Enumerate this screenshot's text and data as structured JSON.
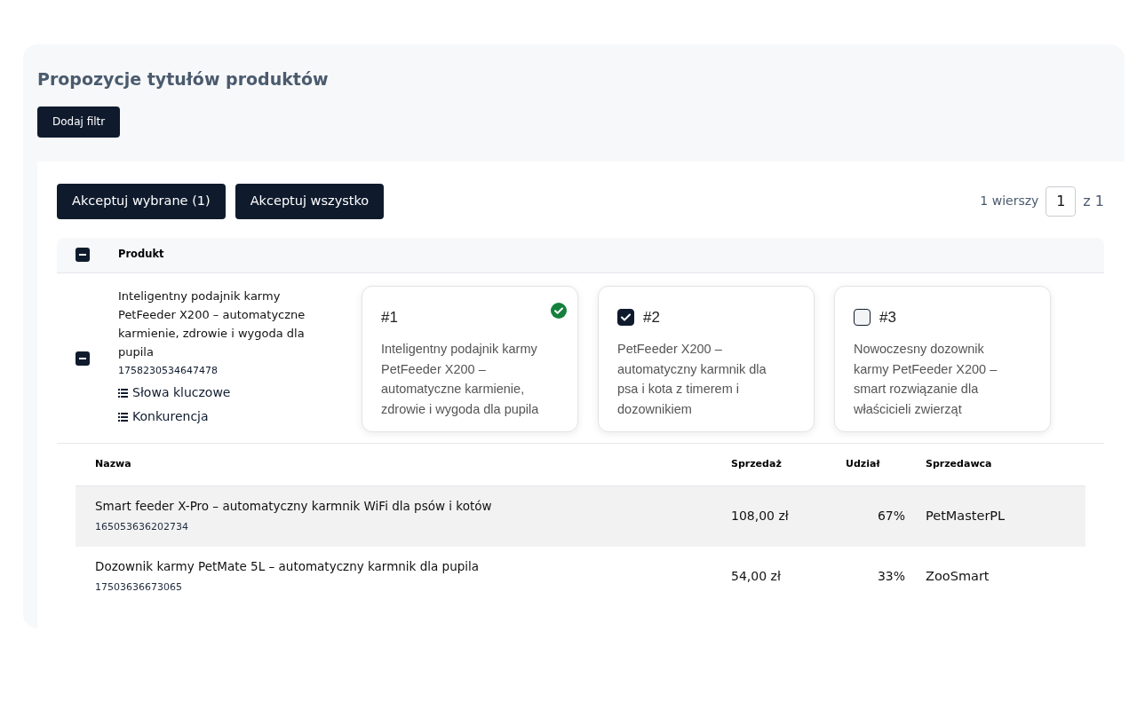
{
  "title": "Propozycje tytułów produktów",
  "filter_button": "Dodaj filtr",
  "actions": [
    "Akceptuj wybrane (1)",
    "Akceptuj wszystko"
  ],
  "pagination": {
    "rows_label": "1 wierszy",
    "page": "1",
    "of": "z 1"
  },
  "table": {
    "header": {
      "indeterminate": true,
      "column": "Produkt"
    },
    "product": {
      "indeterminate": true,
      "name": "Inteligentny podajnik karmy PetFeeder X200 – automatyczne karmienie, zdrowie i wygoda dla pupila",
      "id": "1758230534647478",
      "links": [
        "Słowa kluczowe",
        "Konkurencja"
      ],
      "proposals": [
        {
          "kind": "accepted",
          "number": "#1",
          "text": "Inteligentny podajnik karmy PetFeeder X200 – automatyczne karmienie, zdrowie i wygoda dla pupila"
        },
        {
          "kind": "checkbox",
          "number": "#2",
          "checked": true,
          "text": "PetFeeder X200 – automatyczny karmnik dla psa i kota z timerem i dozownikiem"
        },
        {
          "kind": "checkbox",
          "number": "#3",
          "checked": false,
          "text": "Nowoczesny dozownik karmy PetFeeder X200 – smart rozwiązanie dla właścicieli zwierząt"
        }
      ]
    }
  },
  "competitors": {
    "columns": [
      "Nazwa",
      "Sprzedaż",
      "Udział",
      "Sprzedawca"
    ],
    "rows": [
      {
        "highlighted": true,
        "name": "Smart feeder X-Pro – automatyczny karmnik WiFi dla psów i kotów",
        "id": "165053636202734",
        "sales": "108,00 zł",
        "share": "67%",
        "seller": "PetMasterPL"
      },
      {
        "highlighted": false,
        "name": "Dozownik karmy PetMate 5L – automatyczny karmnik dla pupila",
        "id": "17503636673065",
        "sales": "54,00 zł",
        "share": "33%",
        "seller": "ZooSmart"
      }
    ]
  }
}
